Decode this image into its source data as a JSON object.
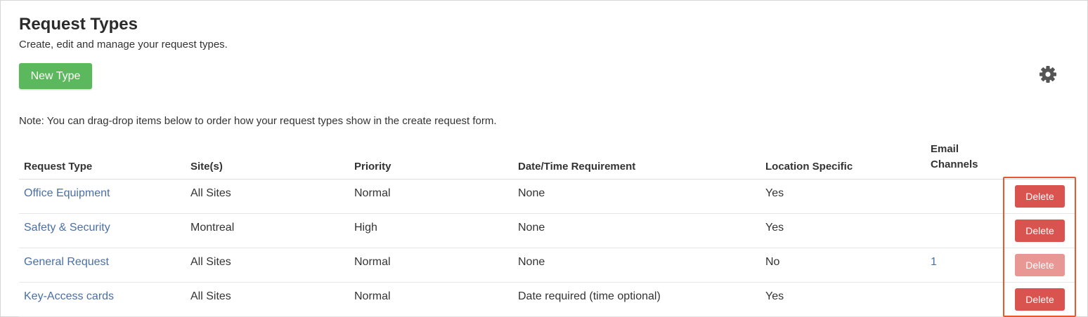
{
  "header": {
    "title": "Request Types",
    "subtitle": "Create, edit and manage your request types.",
    "new_button_label": "New Type"
  },
  "note": "Note: You can drag-drop items below to order how your request types show in the create request form.",
  "table": {
    "columns": {
      "request_type": "Request Type",
      "sites": "Site(s)",
      "priority": "Priority",
      "datetime": "Date/Time Requirement",
      "location": "Location Specific",
      "email_line1": "Email",
      "email_line2": "Channels"
    },
    "rows": [
      {
        "name": "Office Equipment",
        "sites": "All Sites",
        "priority": "Normal",
        "datetime": "None",
        "location": "Yes",
        "email": "",
        "action": "Delete",
        "action_enabled": true
      },
      {
        "name": "Safety & Security",
        "sites": "Montreal",
        "priority": "High",
        "datetime": "None",
        "location": "Yes",
        "email": "",
        "action": "Delete",
        "action_enabled": true
      },
      {
        "name": "General Request",
        "sites": "All Sites",
        "priority": "Normal",
        "datetime": "None",
        "location": "No",
        "email": "1",
        "action": "Delete",
        "action_enabled": false
      },
      {
        "name": "Key-Access cards",
        "sites": "All Sites",
        "priority": "Normal",
        "datetime": "Date required (time optional)",
        "location": "Yes",
        "email": "",
        "action": "Delete",
        "action_enabled": true
      }
    ]
  },
  "icons": {
    "settings": "gear-icon"
  },
  "colors": {
    "primary_green": "#5cb85c",
    "danger_red": "#d9534f",
    "danger_red_disabled": "#e99794",
    "link_blue": "#4a6fa5",
    "highlight_orange": "#e8582c"
  }
}
